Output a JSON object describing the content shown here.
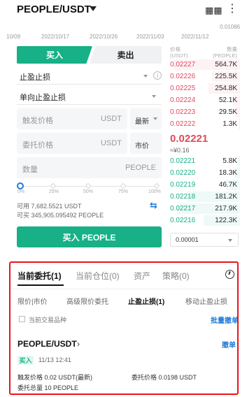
{
  "header": {
    "pair": "PEOPLE/USDT",
    "chart_icon": "candlestick-icon",
    "more_icon": "more-dots-icon"
  },
  "chart_axis": {
    "value_label": "0.01086",
    "dates": [
      "10/09",
      "2022/10/17",
      "2022/10/26",
      "2022/11/03",
      "2022/11/12"
    ]
  },
  "trade_form": {
    "buy_tab": "买入",
    "sell_tab": "卖出",
    "order_type": "止盈止损",
    "sub_type": "单向止盈止损",
    "trigger_price": {
      "placeholder": "触发价格",
      "unit": "USDT",
      "side_button": "最新"
    },
    "order_price": {
      "placeholder": "委托价格",
      "unit": "USDT",
      "side_button": "市价"
    },
    "quantity": {
      "placeholder": "数量",
      "unit": "PEOPLE"
    },
    "slider_marks": [
      "0%",
      "25%",
      "50%",
      "75%",
      "100%"
    ],
    "slider_value_percent": 0,
    "available": "可用 7,682.5521 USDT",
    "can_buy": "可买 345,905.095492 PEOPLE",
    "submit": "买入 PEOPLE"
  },
  "order_book": {
    "price_header": [
      "价格",
      "(USDT)"
    ],
    "qty_header": [
      "数量",
      "(PEOPLE)"
    ],
    "asks": [
      {
        "price": "0.02227",
        "qty": "564.7K"
      },
      {
        "price": "0.02226",
        "qty": "225.5K"
      },
      {
        "price": "0.02225",
        "qty": "254.8K"
      },
      {
        "price": "0.02224",
        "qty": "52.1K"
      },
      {
        "price": "0.02223",
        "qty": "29.5K"
      },
      {
        "price": "0.02222",
        "qty": "1.3K"
      }
    ],
    "last_price": "0.02221",
    "last_fiat": "≈¥0.16",
    "bids": [
      {
        "price": "0.02221",
        "qty": "5.8K"
      },
      {
        "price": "0.02220",
        "qty": "18.3K"
      },
      {
        "price": "0.02219",
        "qty": "46.7K"
      },
      {
        "price": "0.02218",
        "qty": "181.2K"
      },
      {
        "price": "0.02217",
        "qty": "217.9K"
      },
      {
        "price": "0.02216",
        "qty": "122.3K"
      }
    ],
    "depth": "0.00001"
  },
  "orders_panel": {
    "tabs": [
      "当前委托(1)",
      "当前仓位(0)",
      "资产",
      "策略(0)"
    ],
    "sub_tabs": [
      "限价|市价",
      "高级限价委托",
      "止盈止损(1)",
      "移动止盈止损"
    ],
    "filter_label": "当前交易品种",
    "batch_cancel": "批量撤单",
    "order": {
      "pair": "PEOPLE/USDT",
      "cancel": "撤单",
      "side": "买入",
      "time": "11/13 12:41",
      "trigger": "触发价格 0.02 USDT(最新)",
      "order_price": "委托价格 0.0198 USDT",
      "total": "委托总量 10 PEOPLE"
    }
  },
  "colors": {
    "buy": "#17b087",
    "sell": "#e04a5d",
    "accent": "#1f7ad6",
    "highlight_border": "#e8141c"
  }
}
